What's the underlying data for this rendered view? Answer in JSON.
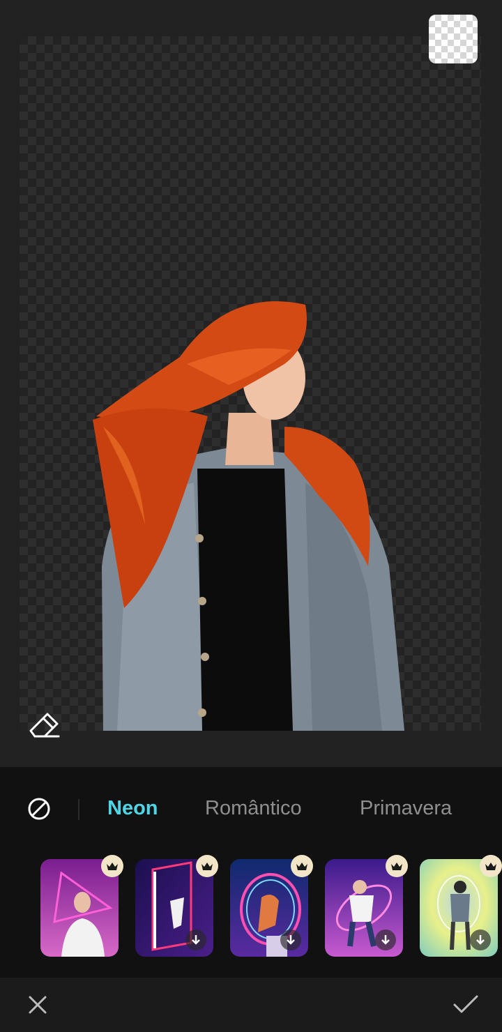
{
  "editor": {
    "canvas_icons": [
      "transparent-background-icon",
      "eraser-icon"
    ]
  },
  "category_tabs": [
    {
      "label": "Neon",
      "active": true
    },
    {
      "label": "Romântico",
      "active": false
    },
    {
      "label": "Primavera",
      "active": false
    }
  ],
  "templates": [
    {
      "name": "neon-triangle",
      "premium": true,
      "downloaded": true
    },
    {
      "name": "neon-portal",
      "premium": true,
      "downloaded": false
    },
    {
      "name": "neon-ring-orange",
      "premium": true,
      "downloaded": false
    },
    {
      "name": "neon-planet-ring",
      "premium": true,
      "downloaded": false
    },
    {
      "name": "yellow-tunnel",
      "premium": true,
      "downloaded": false
    }
  ],
  "colors": {
    "accent": "#4fd6e6",
    "panel_bg": "#111111",
    "inactive_tab": "#8f8f8f",
    "premium_badge": "#f3e6c8"
  },
  "footer": {
    "icons": [
      "close-icon",
      "check-icon"
    ]
  }
}
